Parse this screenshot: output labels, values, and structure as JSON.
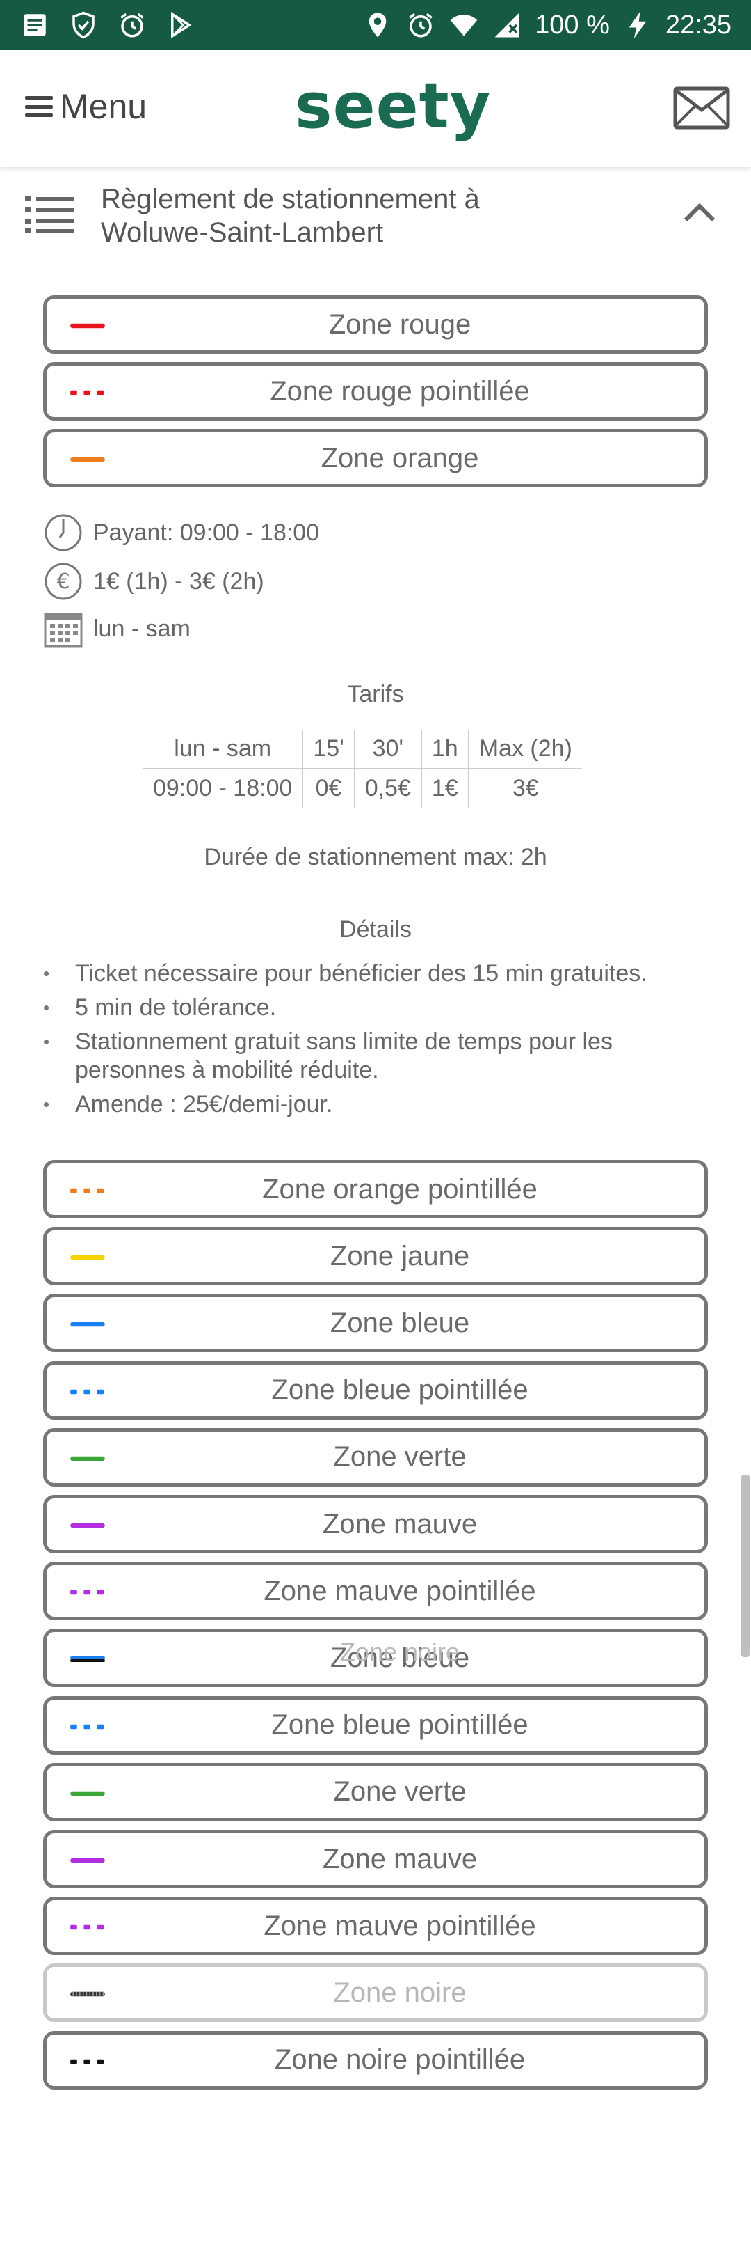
{
  "status_bar": {
    "battery": "100 %",
    "time": "22:35"
  },
  "header": {
    "menu_label": "Menu",
    "logo": "seety"
  },
  "rules": {
    "title_line1": "Règlement de stationnement à",
    "title_line2": "Woluwe-Saint-Lambert"
  },
  "zones_top": [
    {
      "label": "Zone rouge",
      "color": "#e8141b",
      "style": "solid"
    },
    {
      "label": "Zone rouge pointillée",
      "color": "#e8141b",
      "style": "dotted"
    },
    {
      "label": "Zone orange",
      "color": "#f07b1a",
      "style": "solid"
    }
  ],
  "info": {
    "hours": "Payant: 09:00 - 18:00",
    "price": "1€ (1h) - 3€ (2h)",
    "days": "lun - sam"
  },
  "tarifs": {
    "title": "Tarifs",
    "headers": [
      "lun - sam",
      "15'",
      "30'",
      "1h",
      "Max (2h)"
    ],
    "row": [
      "09:00 - 18:00",
      "0€",
      "0,5€",
      "1€",
      "3€"
    ],
    "max_duration": "Durée de stationnement max: 2h"
  },
  "details": {
    "title": "Détails",
    "items": [
      "Ticket nécessaire pour bénéficier des 15 min gratuites.",
      "5 min de tolérance.",
      "Stationnement gratuit sans limite de temps pour les personnes à mobilité réduite.",
      "Amende : 25€/demi-jour."
    ]
  },
  "zones_bottom": [
    {
      "label": "Zone orange pointillée",
      "color": "#f07b1a",
      "style": "dotted"
    },
    {
      "label": "Zone jaune",
      "color": "#f5d400",
      "style": "solid"
    },
    {
      "label": "Zone bleue",
      "color": "#1a7ff0",
      "style": "solid"
    },
    {
      "label": "Zone bleue pointillée",
      "color": "#1a7ff0",
      "style": "dotted"
    },
    {
      "label": "Zone verte",
      "color": "#3aa63a",
      "style": "solid"
    },
    {
      "label": "Zone mauve",
      "color": "#b02fe0",
      "style": "solid"
    },
    {
      "label": "Zone mauve pointillée",
      "color": "#b02fe0",
      "style": "dotted"
    },
    {
      "label": "Zone bleue",
      "overlay_label": "Zone noire",
      "color": "#1a7ff0",
      "style": "solid-black"
    },
    {
      "label": "Zone bleue pointillée",
      "color": "#1a7ff0",
      "style": "dotted"
    },
    {
      "label": "Zone verte",
      "color": "#3aa63a",
      "style": "solid"
    },
    {
      "label": "Zone mauve",
      "color": "#b02fe0",
      "style": "solid"
    },
    {
      "label": "Zone mauve pointillée",
      "color": "#b02fe0",
      "style": "dotted"
    },
    {
      "label": "Zone noire",
      "color": "#333333",
      "style": "striped",
      "faded": true
    },
    {
      "label": "Zone noire pointillée",
      "color": "#111111",
      "style": "dotted"
    }
  ]
}
